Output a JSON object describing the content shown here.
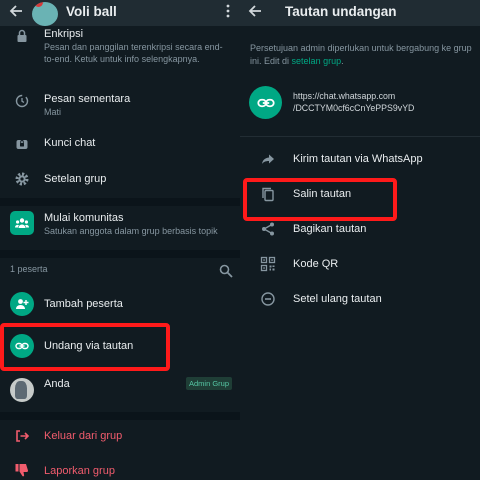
{
  "left": {
    "header": {
      "title": "Voli ball"
    },
    "settings": [
      {
        "label": "Enkripsi",
        "sub": "Pesan dan panggilan terenkripsi secara end-to-end. Ketuk untuk info selengkapnya."
      },
      {
        "label": "Pesan sementara",
        "sub": "Mati"
      },
      {
        "label": "Kunci chat"
      },
      {
        "label": "Setelan grup"
      }
    ],
    "community": {
      "label": "Mulai komunitas",
      "sub": "Satukan anggota dalam grup berbasis topik"
    },
    "participants": {
      "count_label": "1 peserta",
      "add_label": "Tambah peserta",
      "invite_label": "Undang via tautan",
      "member_name": "Anda",
      "member_badge": "Admin Grup"
    },
    "actions": {
      "leave": "Keluar dari grup",
      "report": "Laporkan grup"
    }
  },
  "right": {
    "header": {
      "title": "Tautan undangan"
    },
    "info_text": "Persetujuan admin diperlukan untuk bergabung ke grup ini. Edit di",
    "info_link": "setelan grup",
    "info_end": ".",
    "link": {
      "line1": "https://chat.whatsapp.com",
      "line2": "/DCCTYM0cf6cCnYePPS9vYD"
    },
    "options": [
      {
        "label": "Kirim tautan via WhatsApp",
        "icon": "share-arrow-icon"
      },
      {
        "label": "Salin tautan",
        "icon": "copy-icon"
      },
      {
        "label": "Bagikan tautan",
        "icon": "share-icon"
      },
      {
        "label": "Kode QR",
        "icon": "qr-code-icon"
      },
      {
        "label": "Setel ulang tautan",
        "icon": "reset-icon"
      }
    ]
  },
  "colors": {
    "background": "#111b21",
    "accent": "#00a884",
    "danger": "#f15c6d",
    "highlight": "#ff1a1a",
    "text": "#e9edef",
    "muted": "#8696a0"
  }
}
